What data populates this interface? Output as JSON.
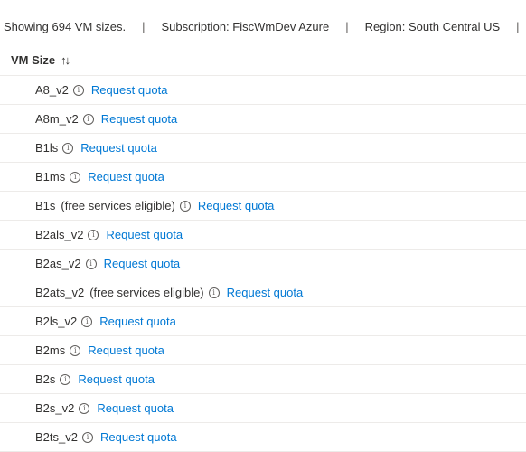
{
  "summary": {
    "count_text": "Showing 694 VM sizes.",
    "separator": "|",
    "subscription_text": "Subscription: FiscWmDev Azure",
    "region_text": "Region: South Central US",
    "trailing_sep": "|"
  },
  "table": {
    "column_header": "VM Size",
    "sort_icon": "sort-up-down-icon",
    "rows": [
      {
        "size": "A8_v2",
        "note": "",
        "link": "Request quota"
      },
      {
        "size": "A8m_v2",
        "note": "",
        "link": "Request quota"
      },
      {
        "size": "B1ls",
        "note": "",
        "link": "Request quota"
      },
      {
        "size": "B1ms",
        "note": "",
        "link": "Request quota"
      },
      {
        "size": "B1s",
        "note": "(free services eligible)",
        "link": "Request quota"
      },
      {
        "size": "B2als_v2",
        "note": "",
        "link": "Request quota"
      },
      {
        "size": "B2as_v2",
        "note": "",
        "link": "Request quota"
      },
      {
        "size": "B2ats_v2",
        "note": "(free services eligible)",
        "link": "Request quota"
      },
      {
        "size": "B2ls_v2",
        "note": "",
        "link": "Request quota"
      },
      {
        "size": "B2ms",
        "note": "",
        "link": "Request quota"
      },
      {
        "size": "B2s",
        "note": "",
        "link": "Request quota"
      },
      {
        "size": "B2s_v2",
        "note": "",
        "link": "Request quota"
      },
      {
        "size": "B2ts_v2",
        "note": "",
        "link": "Request quota"
      }
    ]
  },
  "colors": {
    "link": "#0078d4",
    "text": "#323130",
    "divider": "#edebe9"
  }
}
